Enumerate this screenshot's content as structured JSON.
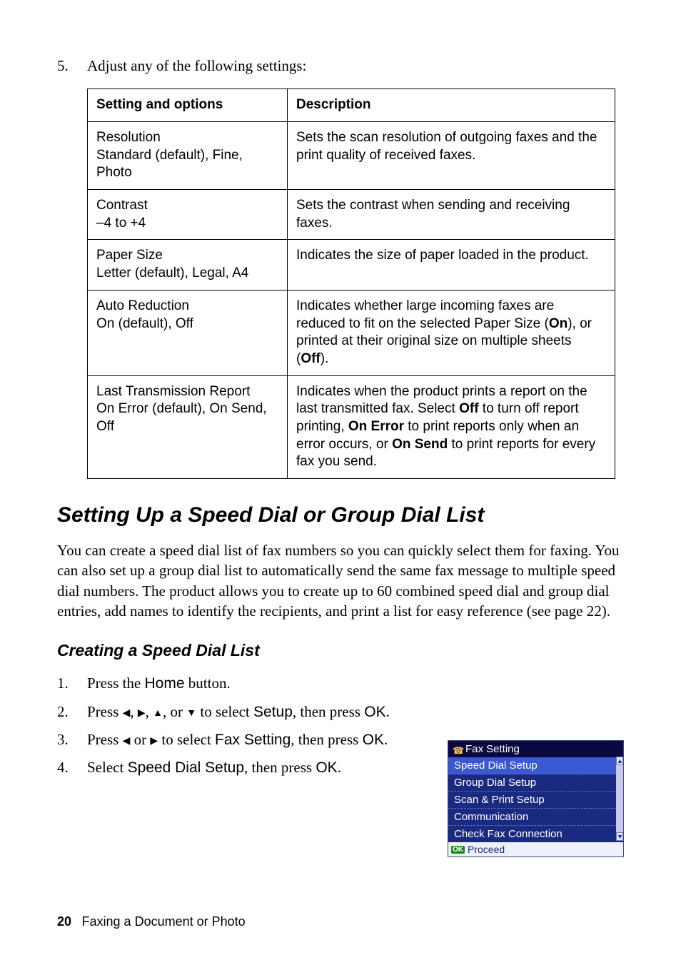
{
  "intro_step": {
    "num": "5.",
    "text": "Adjust any of the following settings:"
  },
  "table": {
    "headers": {
      "col1": "Setting and options",
      "col2": "Description"
    },
    "rows": [
      {
        "name": "Resolution",
        "opts": "Standard (default), Fine, Photo",
        "desc_html": "Sets the scan resolution of outgoing faxes and the print quality of received faxes."
      },
      {
        "name": "Contrast",
        "opts": "–4 to +4",
        "desc_html": "Sets the contrast when sending and receiving faxes."
      },
      {
        "name": "Paper Size",
        "opts": "Letter (default), Legal, A4",
        "desc_html": "Indicates the size of paper loaded in the product."
      },
      {
        "name": "Auto Reduction",
        "opts": "On (default), Off",
        "desc_html": "Indicates whether large incoming faxes are reduced to fit on the selected Paper Size (<b>On</b>), or printed at their original size on multiple sheets (<b>Off</b>)."
      },
      {
        "name": "Last Transmission Report",
        "opts": "On Error (default), On Send, Off",
        "desc_html": "Indicates when the product prints a report on the last transmitted fax. Select <b>Off</b> to turn off report printing, <b>On Error</b> to print reports only when an error occurs, or <b>On Send</b> to print reports for every fax you send."
      }
    ]
  },
  "section_title": "Setting Up a Speed Dial or Group Dial List",
  "section_para": "You can create a speed dial list of fax numbers so you can quickly select them for faxing. You can also set up a group dial list to automatically send the same fax message to multiple speed dial numbers. The product allows you to create up to 60 combined speed dial and group dial entries, add names to identify the recipients, and print a list for easy reference (see page 22).",
  "subsection_title": "Creating a Speed Dial List",
  "steps": [
    {
      "num": "1.",
      "html": "Press the <span class='bold-sans'>Home</span> button."
    },
    {
      "num": "2.",
      "html": "Press <span class='arrow'>◀</span>, <span class='arrow'>▶</span>, <span class='arrow'>▲</span>, or <span class='arrow'>▼</span> to select <span class='bold-sans'>Setup</span>, then press <span class='bold-sans'>OK</span>."
    },
    {
      "num": "3.",
      "html": "Press <span class='arrow'>◀</span> or <span class='arrow'>▶</span> to select <span class='bold-sans'>Fax Setting</span>, then press <span class='bold-sans'>OK</span>."
    },
    {
      "num": "4.",
      "html": "Select <span class='bold-sans'>Speed Dial Setup</span>, then press <span class='bold-sans'>OK</span>."
    }
  ],
  "device": {
    "title": "Fax Setting",
    "items": [
      {
        "label": "Speed Dial Setup",
        "selected": true
      },
      {
        "label": "Group Dial Setup",
        "selected": false
      },
      {
        "label": "Scan & Print Setup",
        "selected": false
      },
      {
        "label": "Communication",
        "selected": false
      },
      {
        "label": "Check Fax Connection",
        "selected": false
      }
    ],
    "footer_badge": "OK",
    "footer_text": "Proceed"
  },
  "footer": {
    "page": "20",
    "chapter": "Faxing a Document or Photo"
  }
}
